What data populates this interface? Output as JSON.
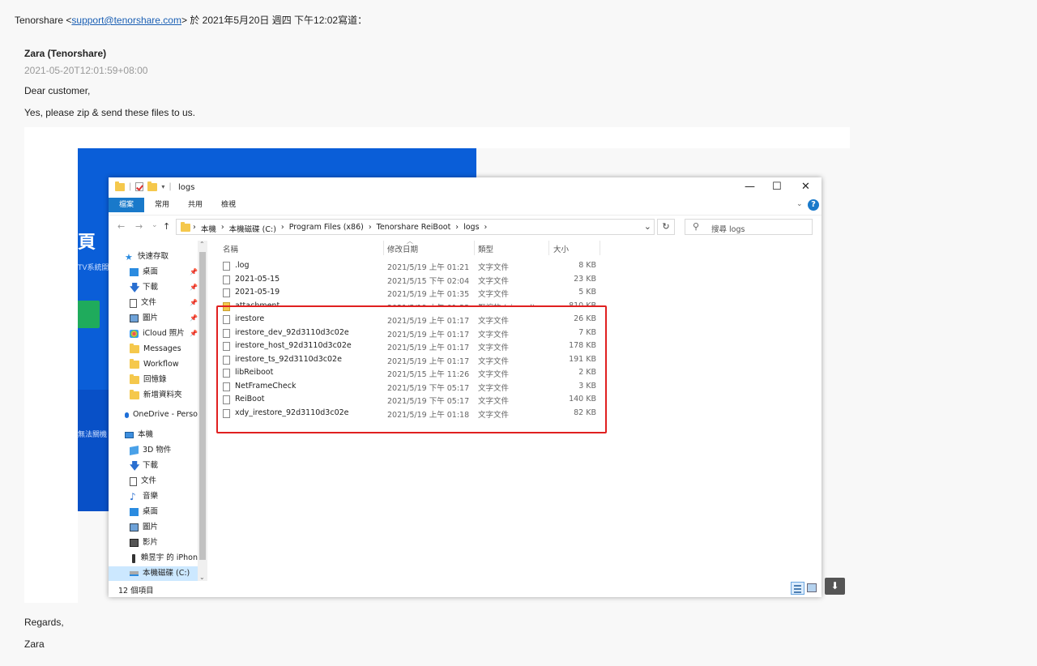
{
  "quote_header": {
    "prefix": "Tenorshare <",
    "email": "support@tenorshare.com",
    "suffix": "> 於 2021年5月20日 週四 下午12:02寫道："
  },
  "message": {
    "sender": "Zara (Tenorshare)",
    "timestamp": "2021-05-20T12:01:59+08:00",
    "greeting": "Dear customer,",
    "body": "Yes, please zip & send these files to us.",
    "regards": "Regards,",
    "signature": "Zara"
  },
  "background_app": {
    "glyph": "頁",
    "text1": "TV系統開",
    "text2": "無法關機"
  },
  "explorer": {
    "window_title": "logs",
    "window_controls": {
      "minimize": "—",
      "maximize": "☐",
      "close": "✕"
    },
    "ribbon_tabs": [
      "檔案",
      "常用",
      "共用",
      "檢視"
    ],
    "help": "?",
    "nav_back": "←",
    "nav_forward": "→",
    "nav_recent": "⌄",
    "nav_up": "↑",
    "breadcrumbs": [
      "本機",
      "本機磁碟 (C:)",
      "Program Files (x86)",
      "Tenorshare ReiBoot",
      "logs"
    ],
    "breadcrumb_sep": "›",
    "search_placeholder": "搜尋 logs",
    "columns": {
      "name": "名稱",
      "date": "修改日期",
      "type": "類型",
      "size": "大小"
    },
    "nav_items": [
      {
        "label": "快速存取",
        "icon": "star-icon"
      },
      {
        "label": "桌面",
        "icon": "desktop-icon",
        "pinned": true
      },
      {
        "label": "下載",
        "icon": "download-icon",
        "pinned": true
      },
      {
        "label": "文件",
        "icon": "document-icon",
        "pinned": true
      },
      {
        "label": "圖片",
        "icon": "pictures-icon",
        "pinned": true
      },
      {
        "label": "iCloud 照片",
        "icon": "icloud-photos-icon",
        "pinned": true
      },
      {
        "label": "Messages",
        "icon": "folder-icon"
      },
      {
        "label": "Workflow",
        "icon": "folder-icon"
      },
      {
        "label": "回憶錄",
        "icon": "folder-icon"
      },
      {
        "label": "新增資料夾",
        "icon": "folder-icon"
      },
      {
        "label": "OneDrive - Perso",
        "icon": "onedrive-icon"
      },
      {
        "label": "本機",
        "icon": "this-pc-icon"
      },
      {
        "label": "3D 物件",
        "icon": "3d-objects-icon"
      },
      {
        "label": "下載",
        "icon": "download-icon"
      },
      {
        "label": "文件",
        "icon": "document-icon"
      },
      {
        "label": "音樂",
        "icon": "music-icon"
      },
      {
        "label": "桌面",
        "icon": "desktop-icon"
      },
      {
        "label": "圖片",
        "icon": "pictures-icon"
      },
      {
        "label": "影片",
        "icon": "videos-icon"
      },
      {
        "label": "賴昱宇 的 iPhon",
        "icon": "iphone-icon"
      },
      {
        "label": "本機磁碟 (C:)",
        "icon": "drive-icon",
        "selected": true
      }
    ],
    "files": [
      {
        "name": ".log",
        "date": "2021/5/19 上午 01:21",
        "type": "文字文件",
        "size": "8 KB"
      },
      {
        "name": "2021-05-15",
        "date": "2021/5/15 下午 02:04",
        "type": "文字文件",
        "size": "23 KB"
      },
      {
        "name": "2021-05-19",
        "date": "2021/5/19 上午 01:35",
        "type": "文字文件",
        "size": "5 KB"
      },
      {
        "name": "attachment",
        "date": "2021/5/19 上午 01:33",
        "type": "壓縮的 (zipped) ...",
        "size": "810 KB"
      },
      {
        "name": "irestore",
        "date": "2021/5/19 上午 01:17",
        "type": "文字文件",
        "size": "26 KB"
      },
      {
        "name": "irestore_dev_92d3110d3c02e",
        "date": "2021/5/19 上午 01:17",
        "type": "文字文件",
        "size": "7 KB"
      },
      {
        "name": "irestore_host_92d3110d3c02e",
        "date": "2021/5/19 上午 01:17",
        "type": "文字文件",
        "size": "178 KB"
      },
      {
        "name": "irestore_ts_92d3110d3c02e",
        "date": "2021/5/19 上午 01:17",
        "type": "文字文件",
        "size": "191 KB"
      },
      {
        "name": "libReiboot",
        "date": "2021/5/15 上午 11:26",
        "type": "文字文件",
        "size": "2 KB"
      },
      {
        "name": "NetFrameCheck",
        "date": "2021/5/19 下午 05:17",
        "type": "文字文件",
        "size": "3 KB"
      },
      {
        "name": "ReiBoot",
        "date": "2021/5/19 下午 05:17",
        "type": "文字文件",
        "size": "140 KB"
      },
      {
        "name": "xdy_irestore_92d3110d3c02e",
        "date": "2021/5/19 上午 01:18",
        "type": "文字文件",
        "size": "82 KB"
      }
    ],
    "status_count": "12 個項目"
  },
  "download_button_glyph": "⬇",
  "colors": {
    "highlight_box": "#e02020",
    "link": "#1a5fb4",
    "ribbon_active": "#1979ca"
  }
}
